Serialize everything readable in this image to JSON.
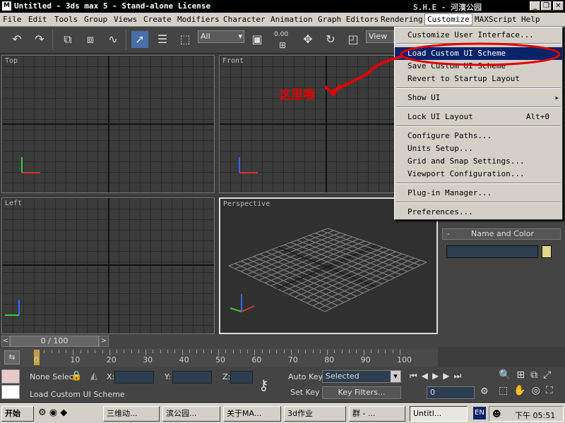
{
  "window": {
    "title": "Untitled - 3ds max 5 - Stand-alone License",
    "title_extra": "S.H.E - 河濱公园",
    "minimize": "_",
    "maximize": "❐",
    "close": "✕"
  },
  "menubar": {
    "items": [
      {
        "label": "File"
      },
      {
        "label": "Edit"
      },
      {
        "label": "Tools"
      },
      {
        "label": "Group"
      },
      {
        "label": "Views"
      },
      {
        "label": "Create"
      },
      {
        "label": "Modifiers"
      },
      {
        "label": "Character"
      },
      {
        "label": "Animation"
      },
      {
        "label": "Graph Editors"
      },
      {
        "label": "Rendering"
      },
      {
        "label": "Customize"
      },
      {
        "label": "MAXScript"
      },
      {
        "label": "Help"
      }
    ]
  },
  "toolbar": {
    "selection_filter": "All",
    "spinner_value": "0.00",
    "view_label": "View"
  },
  "viewports": {
    "top": "Top",
    "front": "Front",
    "left": "Left",
    "perspective": "Perspective"
  },
  "customize_menu": {
    "items": [
      {
        "label": "Customize User Interface..."
      },
      {
        "label": "Load Custom UI Scheme"
      },
      {
        "label": "Save Custom UI Scheme"
      },
      {
        "label": "Revert to Startup Layout"
      },
      {
        "label": "Show UI"
      },
      {
        "label": "Lock UI Layout",
        "shortcut": "Alt+0"
      },
      {
        "label": "Configure Paths..."
      },
      {
        "label": "Units Setup..."
      },
      {
        "label": "Grid and Snap Settings..."
      },
      {
        "label": "Viewport Configuration..."
      },
      {
        "label": "Plug-in Manager..."
      },
      {
        "label": "Preferences..."
      }
    ]
  },
  "annotation": {
    "text": "这里哦",
    "color": "#e00000"
  },
  "command_panel": {
    "rollout_minus": "-",
    "rollout_title": "Name and Color",
    "swatch_color": "#e6d68a"
  },
  "timeline": {
    "frame_counter": "0 / 100",
    "prev": "<",
    "next": ">",
    "ticks": [
      "0",
      "10",
      "20",
      "30",
      "40",
      "50",
      "60",
      "70",
      "80",
      "90",
      "100"
    ]
  },
  "status": {
    "selection": "None Selec",
    "x_label": "X:",
    "y_label": "Y:",
    "z_label": "Z:",
    "prompt": "Load Custom UI Scheme",
    "auto_key": "Auto Key",
    "set_key": "Set Key",
    "key_mode": "Selected",
    "key_filters": "Key Filters...",
    "current_frame": "0"
  },
  "taskbar": {
    "start": "开始",
    "tasks": [
      {
        "label": "三维动..."
      },
      {
        "label": "滨公园..."
      },
      {
        "label": "关于MA..."
      },
      {
        "label": "3d作业"
      },
      {
        "label": "群 - ..."
      },
      {
        "label": "Untitl..."
      }
    ],
    "lang": "EN",
    "clock": "下午 05:51"
  },
  "colors": {
    "highlight": "#0a246a",
    "viewport_bg": "#3b3b3b",
    "ui_bg": "#444444"
  }
}
